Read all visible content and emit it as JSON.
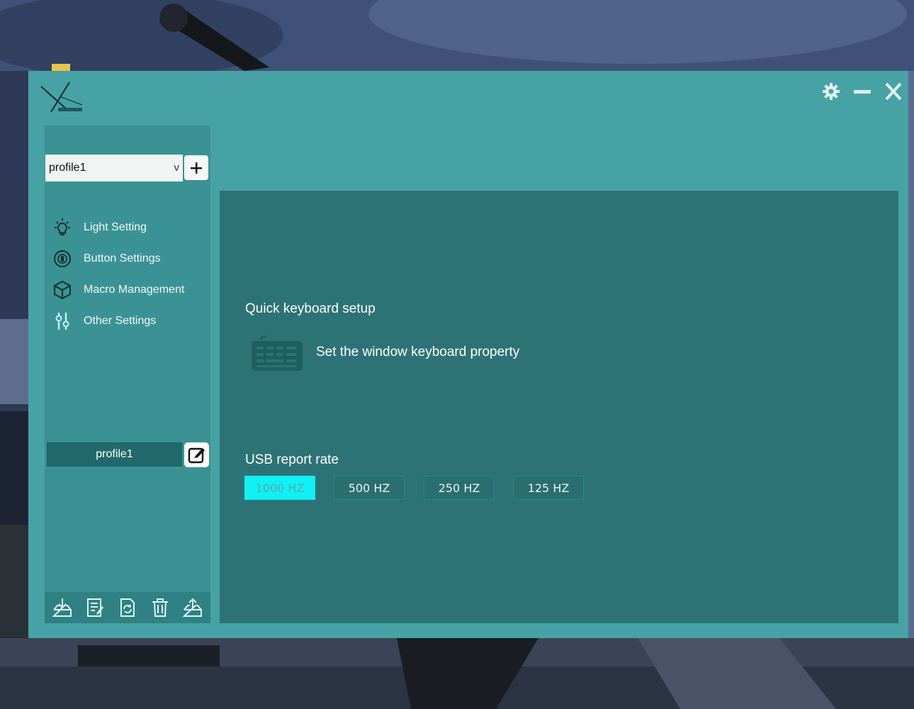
{
  "profile": {
    "selected": "profile1",
    "chevron": "v",
    "add_label": "+",
    "current_name": "profile1"
  },
  "nav": [
    {
      "label": "Light Setting",
      "icon": "lightbulb-icon"
    },
    {
      "label": "Button Settings",
      "icon": "button-settings-icon"
    },
    {
      "label": "Macro Management",
      "icon": "cube-icon"
    },
    {
      "label": "Other Settings",
      "icon": "sliders-icon"
    }
  ],
  "toolbar": [
    {
      "icon": "import-icon"
    },
    {
      "icon": "document-icon"
    },
    {
      "icon": "reset-icon"
    },
    {
      "icon": "trash-icon"
    },
    {
      "icon": "export-icon"
    }
  ],
  "main": {
    "quick_title": "Quick keyboard setup",
    "keyboard_label": "Set the window keyboard property",
    "usb_title": "USB report rate",
    "rates": [
      "1000 HZ",
      "500 HZ",
      "250 HZ",
      "125 HZ"
    ],
    "active_rate": "1000 HZ"
  },
  "colors": {
    "window_bg": "#46a2a5",
    "sidebar_bg": "#3b9294",
    "content_bg": "#2d7375",
    "rate_active": "#0ff1f5"
  }
}
